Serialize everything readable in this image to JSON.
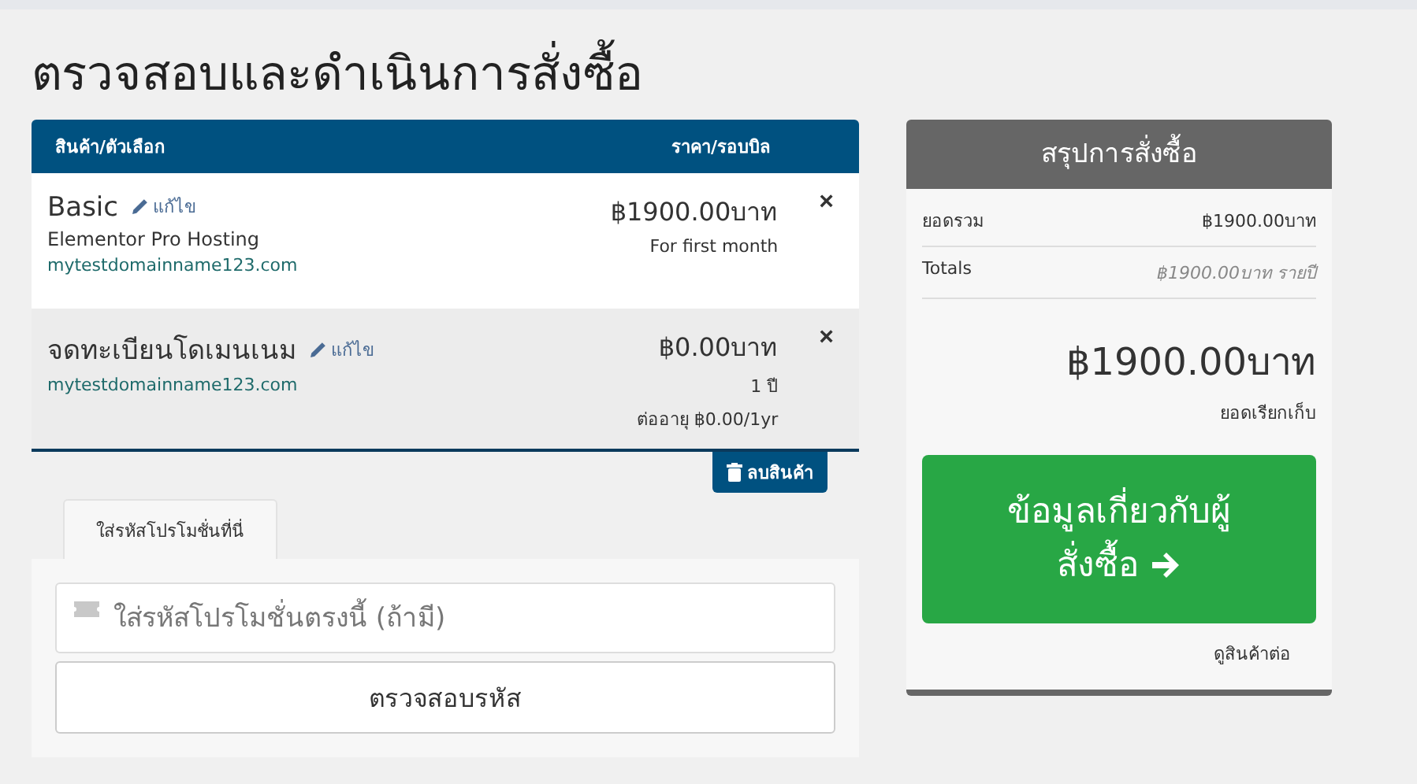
{
  "page_title": "ตรวจสอบและดำเนินการสั่งซื้อ",
  "cart": {
    "columns": [
      "สินค้า/ตัวเลือก",
      "ราคา/รอบบิล"
    ],
    "items": [
      {
        "name": "Basic",
        "edit": "แก้ไข",
        "subtitle": "Elementor Pro Hosting",
        "domain": "mytestdomainname123.com",
        "price": "฿1900.00บาท",
        "price_notes": [
          "For first month"
        ],
        "remove": "×"
      },
      {
        "name": "จดทะเบียนโดเมนเนม",
        "edit": "แก้ไข",
        "domain": "mytestdomainname123.com",
        "price": "฿0.00บาท",
        "price_notes": [
          "1 ปี",
          "ต่ออายุ ฿0.00/1yr"
        ],
        "remove": "×"
      }
    ],
    "empty_button": "ลบสินค้า"
  },
  "promo": {
    "tabs": [
      {
        "label": "ใส่รหัสโปรโมชั่นที่นี่",
        "selected": true
      }
    ],
    "placeholder": "ใส่รหัสโปรโมชั่นตรงนี้ (ถ้ามี)",
    "validate_button": "ตรวจสอบรหัส"
  },
  "summary": {
    "title": "สรุปการสั่งซื้อ",
    "rows": [
      {
        "label": "ยอดรวม",
        "value": "฿1900.00บาท",
        "italic": false
      },
      {
        "label": "Totals",
        "value": "฿1900.00บาท รายปี",
        "italic": true
      }
    ],
    "total": "฿1900.00บาท",
    "total_label": "ยอดเรียกเก็บ",
    "checkout_button": "ข้อมูลเกี่ยวกับผู้สั่งซื้อ",
    "continue_link": "ดูสินค้าต่อ"
  }
}
